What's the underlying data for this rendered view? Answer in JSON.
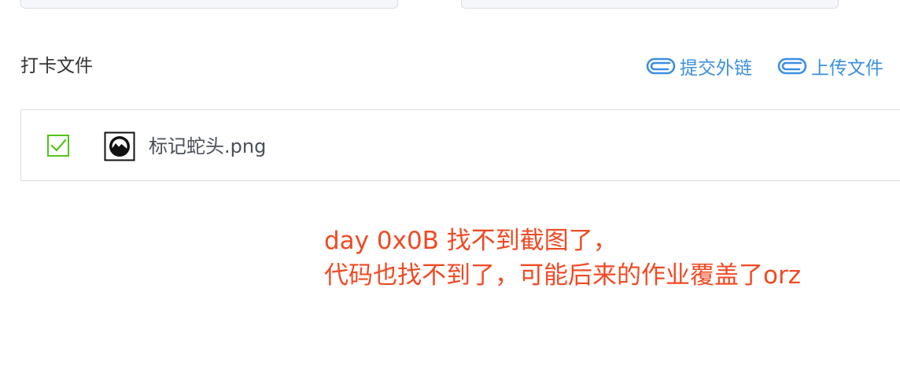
{
  "section": {
    "title": "打卡文件"
  },
  "actions": {
    "submit_link_label": "提交外链",
    "upload_file_label": "上传文件"
  },
  "file": {
    "name": "标记蛇头.png",
    "checked": true
  },
  "note": {
    "line1": "day 0x0B  找不到截图了，",
    "line2": "代码也找不到了，可能后来的作业覆盖了orz"
  },
  "colors": {
    "accent": "#3b8fe0",
    "check": "#52c41a",
    "note": "#f04a24",
    "text": "#333333"
  },
  "icons": {
    "link": "paperclip-link-icon",
    "check": "checkbox-checked-icon",
    "image": "image-file-icon"
  }
}
